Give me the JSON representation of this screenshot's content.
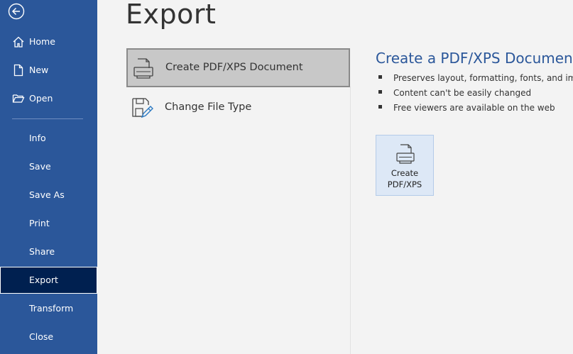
{
  "sidebar": {
    "items": [
      {
        "label": "Home",
        "icon": "home-icon"
      },
      {
        "label": "New",
        "icon": "new-document-icon"
      },
      {
        "label": "Open",
        "icon": "folder-open-icon"
      },
      {
        "label": "Info"
      },
      {
        "label": "Save"
      },
      {
        "label": "Save As"
      },
      {
        "label": "Print"
      },
      {
        "label": "Share"
      },
      {
        "label": "Export",
        "active": true
      },
      {
        "label": "Transform"
      },
      {
        "label": "Close"
      }
    ],
    "back_icon": "back-arrow-icon",
    "color": "#2b579a",
    "active_color": "#002050"
  },
  "main": {
    "title": "Export",
    "options": [
      {
        "label": "Create PDF/XPS Document",
        "icon": "pdf-document-icon",
        "selected": true
      },
      {
        "label": "Change File Type",
        "icon": "change-file-type-icon"
      }
    ]
  },
  "detail": {
    "title": "Create a PDF/XPS Document",
    "bullets": [
      "Preserves layout, formatting, fonts, and images",
      "Content can't be easily changed",
      "Free viewers are available on the web"
    ],
    "button": {
      "line1": "Create",
      "line2": "PDF/XPS",
      "icon": "pdf-document-icon"
    }
  }
}
